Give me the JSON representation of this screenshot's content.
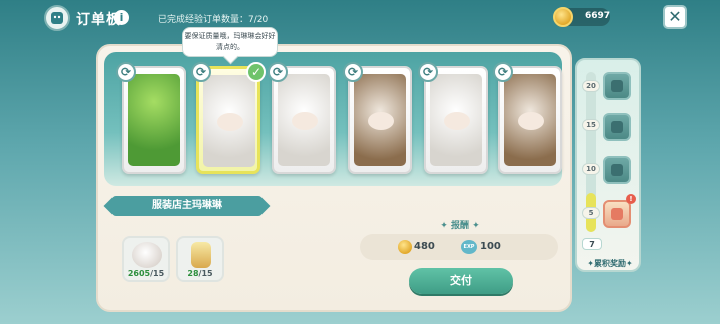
{
  "header": {
    "title": "订单板",
    "info_icon": "i",
    "progress_label": "已完成经验订单数量：",
    "progress_value": "7/20",
    "coins": "6697",
    "close_icon": "✕"
  },
  "speech_bubble": "要保证质量哦，玛琳琳会好好清点的。",
  "cards": [
    {
      "art": "green-plant-doll",
      "selected": false
    },
    {
      "art": "white-sheep-doll",
      "selected": true
    },
    {
      "art": "white-sheep-doll",
      "selected": false
    },
    {
      "art": "brown-aviator-doll",
      "selected": false
    },
    {
      "art": "white-sheep-doll",
      "selected": false
    },
    {
      "art": "brown-aviator-doll",
      "selected": false
    }
  ],
  "shop": {
    "name": "服装店主玛琳琳"
  },
  "items": [
    {
      "icon": "cotton-icon",
      "have": "2605",
      "need": "/15"
    },
    {
      "icon": "bottle-icon",
      "have": "28",
      "need": "/15"
    }
  ],
  "reward": {
    "title": "报酬",
    "coins": "480",
    "exp_label": "EXP",
    "exp": "100"
  },
  "deliver_label": "交付",
  "side_panel": {
    "levels": [
      "20",
      "15",
      "10",
      "5"
    ],
    "current_level": "7",
    "badge": "!",
    "accumulate_label": "累积奖励"
  },
  "colors": {
    "accent": "#4b9ea0",
    "selected_card": "#e7e35a",
    "deliver_button": "#4fb095"
  }
}
